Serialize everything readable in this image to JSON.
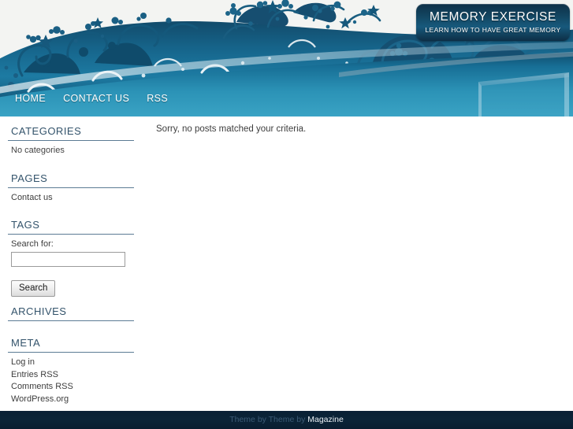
{
  "header": {
    "site_title": "MEMORY EXERCISE",
    "site_description": "LEARN HOW TO HAVE GREAT MEMORY"
  },
  "nav": {
    "items": [
      {
        "label": "HOME"
      },
      {
        "label": "CONTACT US"
      },
      {
        "label": "RSS"
      }
    ]
  },
  "sidebar": {
    "widgets": [
      {
        "title": "CATEGORIES",
        "items": [
          {
            "label": "No categories"
          }
        ]
      },
      {
        "title": "PAGES",
        "items": [
          {
            "label": "Contact us"
          }
        ]
      },
      {
        "title": "TAGS",
        "items": []
      },
      {
        "title": "ARCHIVES",
        "items": []
      },
      {
        "title": "META",
        "items": [
          {
            "label": "Log in"
          },
          {
            "label": "Entries RSS"
          },
          {
            "label": "Comments RSS"
          },
          {
            "label": "WordPress.org"
          }
        ]
      }
    ],
    "search": {
      "label": "Search for:",
      "value": "",
      "placeholder": "",
      "button_label": "Search"
    }
  },
  "main": {
    "message": "Sorry, no posts matched your criteria."
  },
  "footer": {
    "prefix": "Theme by Theme by ",
    "brand": "Magazine"
  },
  "colors": {
    "header_teal_light": "#2f8ab0",
    "header_teal_dark": "#0d4663",
    "nav_gradient_top": "#19698f",
    "nav_gradient_bottom": "#2a8fb4",
    "footer_navy": "#0a2035",
    "widget_heading": "#33536b",
    "rule": "#5b7b94"
  }
}
